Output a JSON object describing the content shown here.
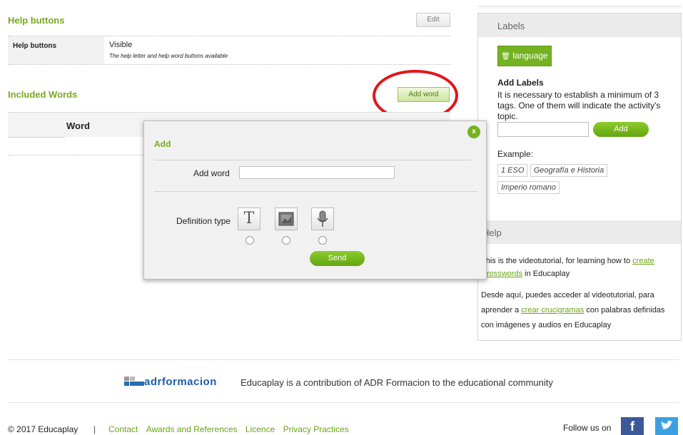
{
  "help_buttons": {
    "heading": "Help buttons",
    "edit_label": "Edit",
    "row_label": "Help buttons",
    "row_value": "Visible",
    "row_note": "The help letter and help word buttons available"
  },
  "included_words": {
    "heading": "Included Words",
    "add_word_label": "Add word",
    "column_word": "Word"
  },
  "modal": {
    "title": "Add",
    "close_symbol": "x",
    "add_word_label": "Add word",
    "add_word_value": "",
    "definition_type_label": "Definition type",
    "types": [
      {
        "name": "text",
        "glyph": "T"
      },
      {
        "name": "image",
        "glyph": ""
      },
      {
        "name": "audio",
        "glyph": ""
      }
    ],
    "send_label": "Send"
  },
  "labels_panel": {
    "header": "Labels",
    "language_button": "language",
    "add_labels_title": "Add Labels",
    "add_labels_desc": "It is necessary to establish a minimum of 3 tags. One of them will indicate the activity's topic.",
    "input_value": "",
    "add_button": "Add",
    "example_label": "Example:",
    "example_tags": [
      "1 ESO",
      "Geografía e Historia",
      "Imperio romano"
    ]
  },
  "help_panel": {
    "header": "Help",
    "p1_pre": "This is the videotutorial, for learning how to ",
    "p1_link": "create Crosswords",
    "p1_post": " in Educaplay",
    "p2_pre": "Desde aquí, puedes acceder al videotutorial, para aprender a ",
    "p2_link": "crear crucigramas",
    "p2_post": " con palabras definidas con imágenes y audios en Educaplay"
  },
  "footer": {
    "brand": "adrformacion",
    "tagline": "Educaplay is a contribution of ADR Formacion to the educational community",
    "copyright": "© 2017 Educaplay",
    "separator": "|",
    "links": [
      "Contact",
      "Awards and References",
      "Licence",
      "Privacy Practices"
    ],
    "follow": "Follow us on",
    "facebook": "f"
  },
  "colors": {
    "accent_green": "#7aa81e",
    "annotation_red": "#e0171b",
    "facebook": "#3b5998",
    "twitter": "#1da1f2"
  }
}
